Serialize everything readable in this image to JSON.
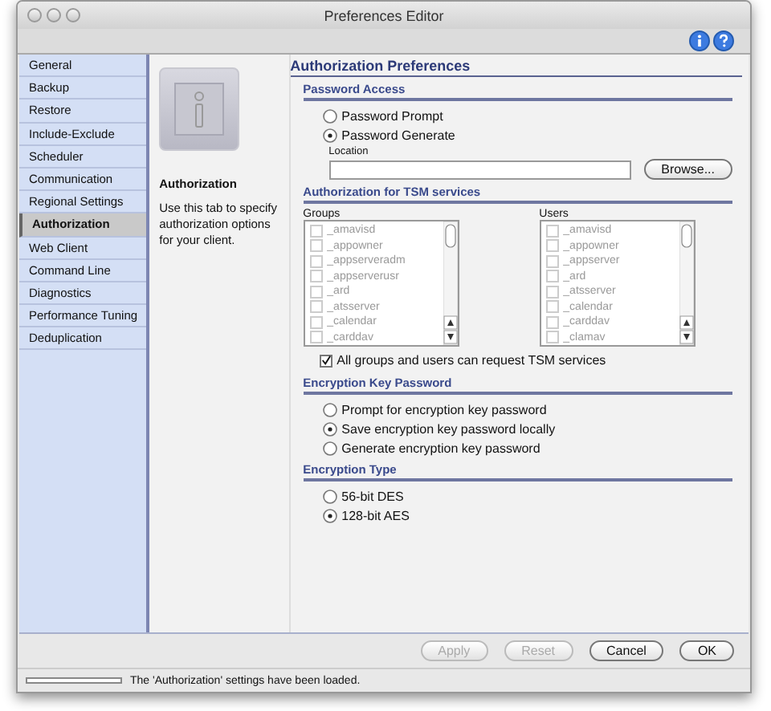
{
  "window": {
    "title": "Preferences Editor"
  },
  "sidebar": {
    "items": [
      {
        "label": "General",
        "selected": false
      },
      {
        "label": "Backup",
        "selected": false
      },
      {
        "label": "Restore",
        "selected": false
      },
      {
        "label": "Include-Exclude",
        "selected": false
      },
      {
        "label": "Scheduler",
        "selected": false
      },
      {
        "label": "Communication",
        "selected": false
      },
      {
        "label": "Regional Settings",
        "selected": false
      },
      {
        "label": "Authorization",
        "selected": true
      },
      {
        "label": "Web Client",
        "selected": false
      },
      {
        "label": "Command Line",
        "selected": false
      },
      {
        "label": "Diagnostics",
        "selected": false
      },
      {
        "label": "Performance Tuning",
        "selected": false
      },
      {
        "label": "Deduplication",
        "selected": false
      }
    ]
  },
  "info": {
    "title": "Authorization",
    "description": "Use this tab to specify authorization options for your client."
  },
  "preferences": {
    "title": "Authorization Preferences",
    "password_access": {
      "heading": "Password Access",
      "options": [
        {
          "label": "Password Prompt",
          "selected": false
        },
        {
          "label": "Password Generate",
          "selected": true
        }
      ],
      "location_label": "Location",
      "browse_button": "Browse..."
    },
    "tsm_services": {
      "heading": "Authorization for TSM services",
      "lists": [
        {
          "heading": "Groups",
          "disabled": true,
          "items": [
            {
              "label": "_amavisd",
              "checked": false
            },
            {
              "label": "_appowner",
              "checked": false
            },
            {
              "label": "_appserveradm",
              "checked": false
            },
            {
              "label": "_appserverusr",
              "checked": false
            },
            {
              "label": "_ard",
              "checked": false
            },
            {
              "label": "_atsserver",
              "checked": false
            },
            {
              "label": "_calendar",
              "checked": false
            },
            {
              "label": "_carddav",
              "checked": false
            }
          ]
        },
        {
          "heading": "Users",
          "disabled": true,
          "items": [
            {
              "label": "_amavisd",
              "checked": false
            },
            {
              "label": "_appowner",
              "checked": false
            },
            {
              "label": "_appserver",
              "checked": false
            },
            {
              "label": "_ard",
              "checked": false
            },
            {
              "label": "_atsserver",
              "checked": false
            },
            {
              "label": "_calendar",
              "checked": false
            },
            {
              "label": "_carddav",
              "checked": false
            },
            {
              "label": "_clamav",
              "checked": false
            }
          ]
        }
      ],
      "all_option": {
        "label": "All groups and users can request TSM services",
        "checked": true
      }
    },
    "encryption_key_password": {
      "heading": "Encryption Key Password",
      "options": [
        {
          "label": "Prompt for encryption key password",
          "selected": false
        },
        {
          "label": "Save encryption key password locally",
          "selected": true
        },
        {
          "label": "Generate encryption key password",
          "selected": false
        }
      ]
    },
    "encryption_type": {
      "heading": "Encryption Type",
      "options": [
        {
          "label": "56-bit DES",
          "selected": false
        },
        {
          "label": "128-bit AES",
          "selected": true
        }
      ]
    }
  },
  "buttons": [
    {
      "label": "Apply",
      "disabled": true
    },
    {
      "label": "Reset",
      "disabled": true
    },
    {
      "label": "Cancel",
      "disabled": false
    },
    {
      "label": "OK",
      "disabled": false
    }
  ],
  "status_bar": {
    "progress": {
      "level": 0
    },
    "message": "The 'Authorization' settings have been loaded."
  }
}
